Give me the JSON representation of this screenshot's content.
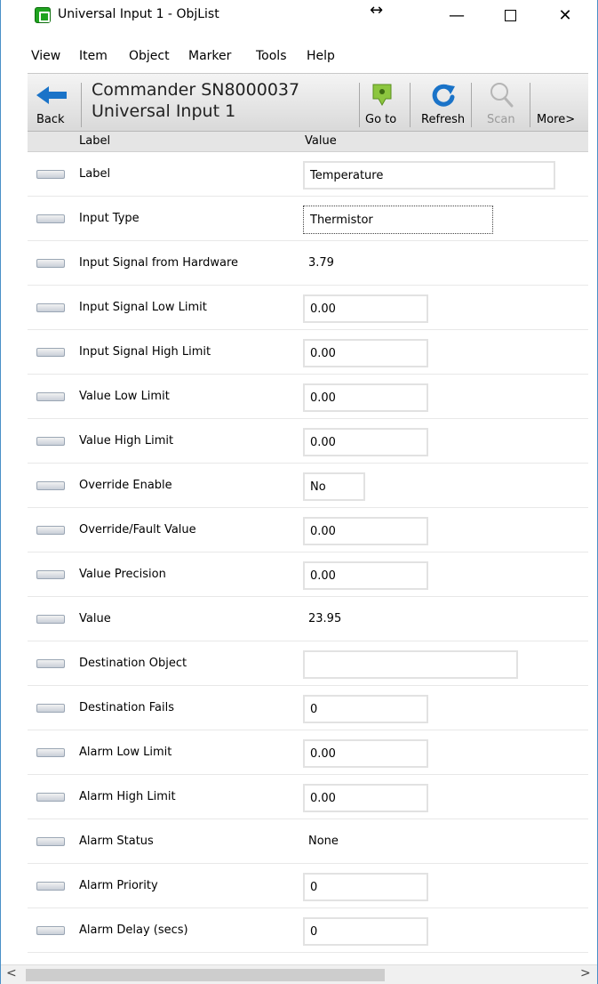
{
  "window": {
    "title": "Universal Input 1 - ObjList",
    "resize_icon": "↔",
    "minimize_glyph": "—",
    "close_glyph": "✕"
  },
  "menu": {
    "items": [
      "View",
      "Item",
      "Object",
      "Marker",
      "Tools",
      "Help"
    ]
  },
  "toolbar": {
    "back_label": "Back",
    "device_name": "Commander SN8000037",
    "object_name": "Universal Input 1",
    "goto_label": "Go to",
    "refresh_label": "Refresh",
    "scan_label": "Scan",
    "more_label": "More>",
    "icons": [
      "back-arrow-icon",
      "goto-map-pin-icon",
      "refresh-icon",
      "scan-magnifier-icon"
    ]
  },
  "table": {
    "header_label": "Label",
    "header_value": "Value",
    "rows": [
      {
        "label": "Label",
        "value": "Temperature",
        "kind": "input"
      },
      {
        "label": "Input Type",
        "value": "Thermistor",
        "kind": "select"
      },
      {
        "label": "Input Signal from Hardware",
        "value": "3.79",
        "kind": "static"
      },
      {
        "label": "Input Signal Low Limit",
        "value": "0.00",
        "kind": "input"
      },
      {
        "label": "Input Signal High Limit",
        "value": "0.00",
        "kind": "input"
      },
      {
        "label": "Value Low Limit",
        "value": "0.00",
        "kind": "input"
      },
      {
        "label": "Value High Limit",
        "value": "0.00",
        "kind": "input"
      },
      {
        "label": "Override Enable",
        "value": "No",
        "kind": "input"
      },
      {
        "label": "Override/Fault Value",
        "value": "0.00",
        "kind": "input"
      },
      {
        "label": "Value Precision",
        "value": "0.00",
        "kind": "input"
      },
      {
        "label": "Value",
        "value": "23.95",
        "kind": "static"
      },
      {
        "label": "Destination Object",
        "value": "",
        "kind": "input"
      },
      {
        "label": "Destination Fails",
        "value": "0",
        "kind": "input"
      },
      {
        "label": "Alarm Low Limit",
        "value": "0.00",
        "kind": "input"
      },
      {
        "label": "Alarm High Limit",
        "value": "0.00",
        "kind": "input"
      },
      {
        "label": "Alarm Status",
        "value": "None",
        "kind": "static"
      },
      {
        "label": "Alarm Priority",
        "value": "0",
        "kind": "input"
      },
      {
        "label": "Alarm Delay (secs)",
        "value": "0",
        "kind": "input"
      }
    ]
  },
  "scrollbar": {
    "left_glyph": "<",
    "right_glyph": ">"
  },
  "colors": {
    "accent": "#1a73c8",
    "app_icon": "#1fa31f",
    "goto_icon": "#8cc63f"
  }
}
